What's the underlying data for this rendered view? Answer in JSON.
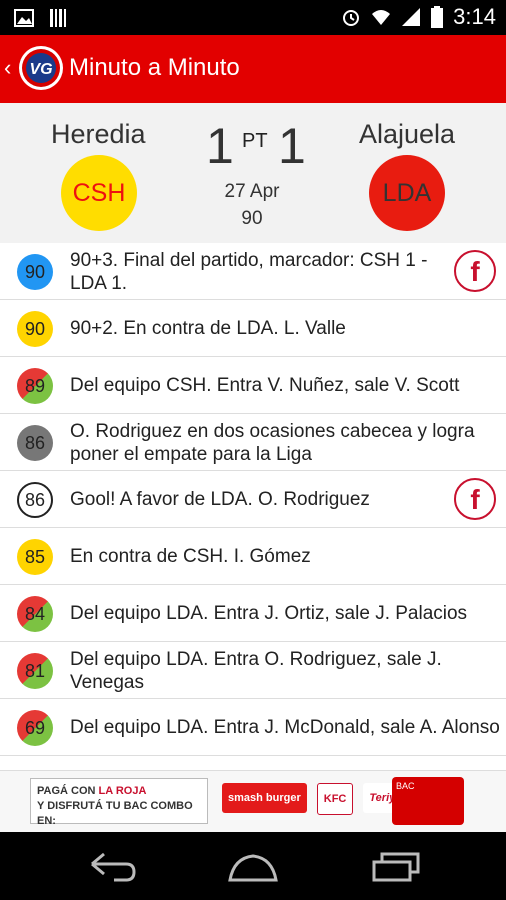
{
  "status_bar": {
    "time": "3:14",
    "icons": [
      "image-icon",
      "barcode-icon",
      "alarm-icon",
      "wifi-icon",
      "signal-icon",
      "battery-icon"
    ]
  },
  "app_bar": {
    "title": "Minuto a Minuto",
    "logo_text": "VG",
    "accent": "#e20000"
  },
  "match": {
    "home_name": "Heredia",
    "away_name": "Alajuela",
    "home_abbr": "CSH",
    "away_abbr": "LDA",
    "home_score": "1",
    "away_score": "1",
    "period": "PT",
    "date": "27 Apr",
    "minute": "90",
    "home_color": "#ffdd00",
    "away_color": "#e81c10"
  },
  "events": [
    {
      "minute": "90",
      "text": "90+3. Final del partido, marcador: CSH 1 - LDA 1.",
      "badge": "blue",
      "share": true
    },
    {
      "minute": "90",
      "text": "90+2. En contra de LDA. L. Valle",
      "badge": "yellow",
      "share": false
    },
    {
      "minute": "89",
      "text": "Del equipo CSH. Entra V. Nuñez, sale V. Scott",
      "badge": "sub",
      "share": false
    },
    {
      "minute": "86",
      "text": "O. Rodriguez en dos ocasiones cabecea y logra poner el empate para la Liga",
      "badge": "comment",
      "share": false
    },
    {
      "minute": "86",
      "text": "Gool! A favor de LDA. O. Rodriguez",
      "badge": "goal",
      "share": true
    },
    {
      "minute": "85",
      "text": "En contra de CSH. I. Gómez",
      "badge": "yellow",
      "share": false
    },
    {
      "minute": "84",
      "text": "Del equipo LDA. Entra J. Ortiz, sale J. Palacios",
      "badge": "sub",
      "share": false
    },
    {
      "minute": "81",
      "text": "Del equipo LDA.  Entra O. Rodriguez, sale J. Venegas",
      "badge": "sub",
      "share": false
    },
    {
      "minute": "69",
      "text": "Del equipo LDA. Entra J. McDonald, sale A. Alonso",
      "badge": "sub",
      "share": false
    }
  ],
  "share_label": "f",
  "ad": {
    "line1": "PAGÁ CON ",
    "line1_strong": "LA ROJA",
    "line2": "Y DISFRUTÁ TU BAC COMBO EN:",
    "brands": [
      "smash burger",
      "KFC",
      "Teriyaki"
    ],
    "card_label": "BAC"
  }
}
